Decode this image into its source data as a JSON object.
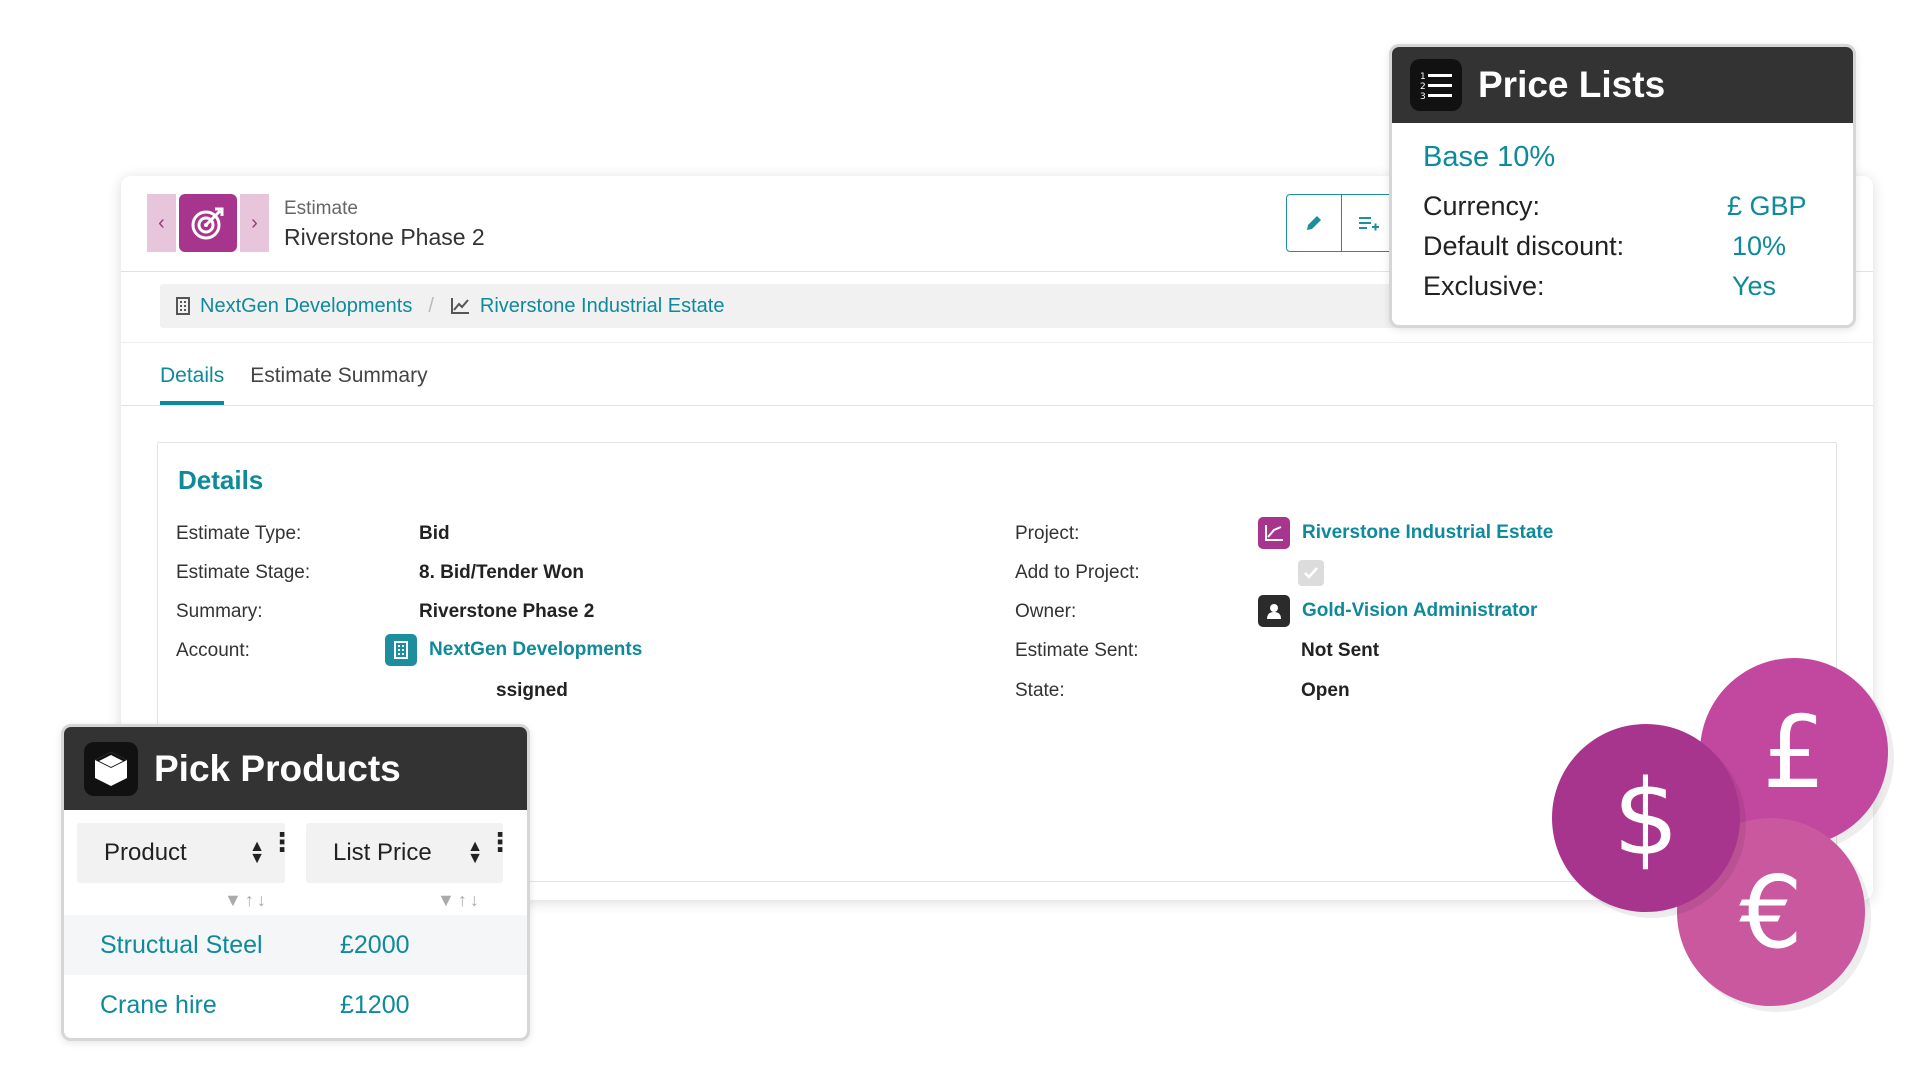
{
  "header": {
    "record_type": "Estimate",
    "record_title": "Riverstone Phase 2"
  },
  "breadcrumb": {
    "account": "NextGen Developments",
    "project": "Riverstone Industrial Estate"
  },
  "tabs": [
    {
      "label": "Details",
      "active": true
    },
    {
      "label": "Estimate Summary",
      "active": false
    }
  ],
  "details": {
    "title": "Details",
    "left": [
      {
        "label": "Estimate Type:",
        "value": "Bid"
      },
      {
        "label": "Estimate Stage:",
        "value": "8. Bid/Tender Won"
      },
      {
        "label": "Summary:",
        "value": "Riverstone Phase 2"
      },
      {
        "label": "Account:",
        "value": "NextGen Developments"
      },
      {
        "label": "",
        "value": "ssigned"
      }
    ],
    "right": [
      {
        "label": "Project:",
        "value": "Riverstone Industrial Estate"
      },
      {
        "label": "Add to Project:",
        "value": ""
      },
      {
        "label": "Owner:",
        "value": "Gold-Vision Administrator"
      },
      {
        "label": "Estimate Sent:",
        "value": "Not Sent"
      },
      {
        "label": "State:",
        "value": "Open"
      }
    ]
  },
  "price_lists": {
    "title": "Price Lists",
    "name": "Base 10%",
    "rows": [
      {
        "label": "Currency:",
        "value": "£ GBP"
      },
      {
        "label": "Default discount:",
        "value": "10%"
      },
      {
        "label": "Exclusive:",
        "value": "Yes"
      }
    ]
  },
  "pick_products": {
    "title": "Pick Products",
    "columns": [
      "Product",
      "List Price"
    ],
    "rows": [
      {
        "product": "Structual Steel",
        "price": "£2000"
      },
      {
        "product": "Crane hire",
        "price": "£1200"
      }
    ]
  },
  "coins": [
    "£",
    "$",
    "€"
  ],
  "colors": {
    "accent": "#0e8a9b",
    "brand": "#a8358d",
    "coin_pound": "#c2479f",
    "coin_dollar": "#a8358d",
    "coin_euro": "#c9589f",
    "dark_header": "#333333"
  }
}
